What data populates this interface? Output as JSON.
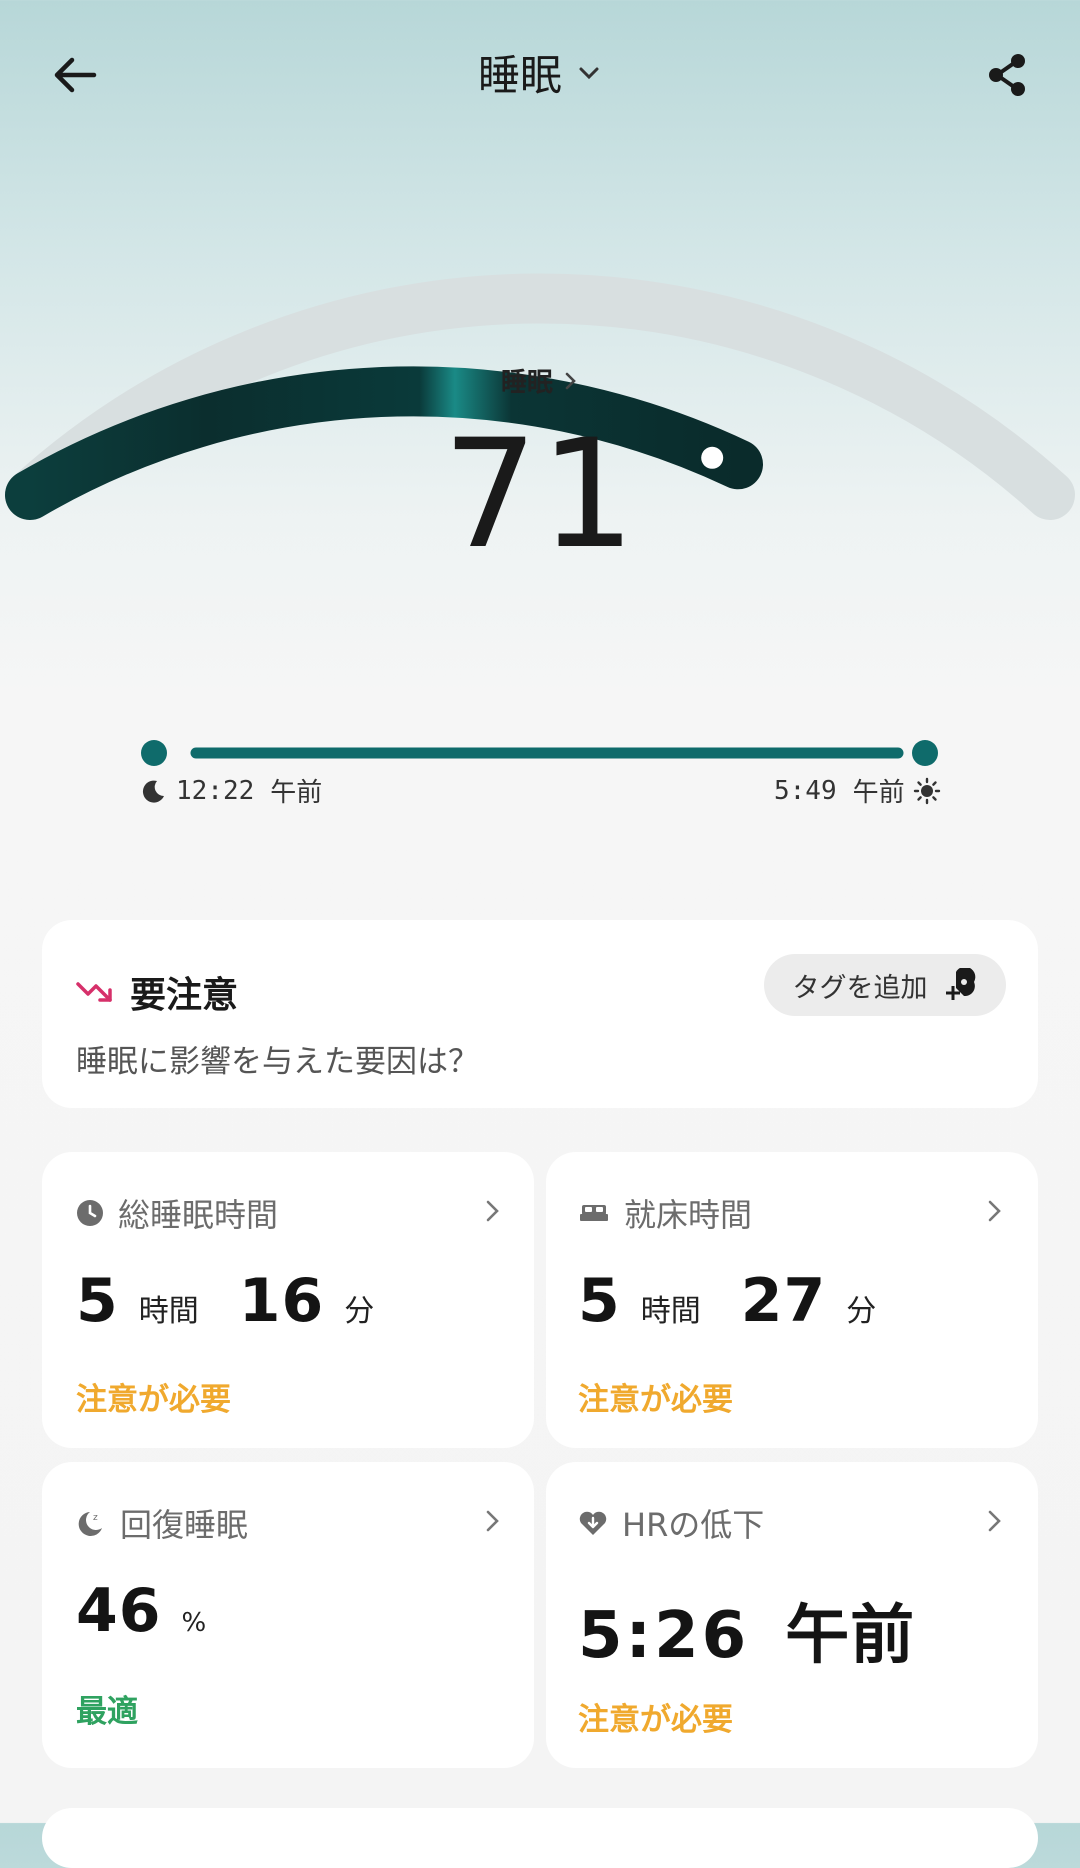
{
  "header": {
    "title": "睡眠",
    "back_icon": "arrow-left-icon",
    "dropdown_icon": "chevron-down-icon",
    "share_icon": "share-icon"
  },
  "score": {
    "label": "睡眠",
    "value": "71",
    "progress_fraction": 0.71,
    "color": "#0f6b6b"
  },
  "timeline": {
    "start_time": "12:22",
    "start_period": "午前",
    "end_time": "5:49",
    "end_period": "午前",
    "start_icon": "moon-icon",
    "end_icon": "sun-icon"
  },
  "attention": {
    "title": "要注意",
    "subtitle": "睡眠に影響を与えた要因は？",
    "tag_button": "タグを追加",
    "trend_icon": "trend-down-icon"
  },
  "metrics": [
    {
      "label": "総睡眠時間",
      "icon": "clock-icon",
      "value1": "5",
      "unit1": "時間",
      "value2": "16",
      "unit2": "分",
      "status": "注意が必要",
      "status_color": "#f0a92e"
    },
    {
      "label": "就床時間",
      "icon": "bed-icon",
      "value1": "5",
      "unit1": "時間",
      "value2": "27",
      "unit2": "分",
      "status": "注意が必要",
      "status_color": "#f0a92e"
    },
    {
      "label": "回復睡眠",
      "icon": "moon-zz-icon",
      "value1": "46",
      "unit1": "%",
      "status": "最適",
      "status_color": "#2fa260"
    },
    {
      "label": "HRの低下",
      "icon": "heart-down-icon",
      "value1": "5:26",
      "unit1": "午前",
      "status": "注意が必要",
      "status_color": "#f0a92e"
    }
  ]
}
